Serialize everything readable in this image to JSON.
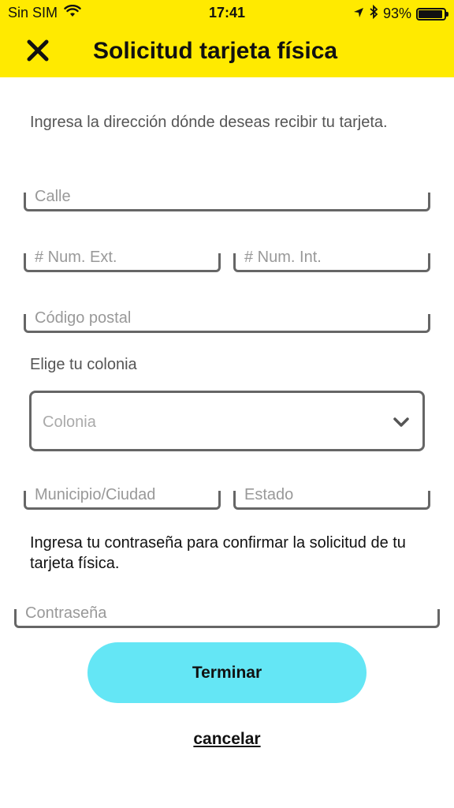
{
  "status_bar": {
    "carrier": "Sin SIM",
    "time": "17:41",
    "battery": "93%",
    "battery_level": 0.93
  },
  "header": {
    "title": "Solicitud tarjeta física",
    "close_icon": "close-icon"
  },
  "form": {
    "intro": "Ingresa la dirección dónde deseas recibir tu tarjeta.",
    "street_placeholder": "Calle",
    "ext_num_placeholder": "# Num. Ext.",
    "int_num_placeholder": "# Num. Int.",
    "postal_code_placeholder": "Código postal",
    "colonia_label": "Elige tu colonia",
    "colonia_placeholder": "Colonia",
    "municipio_placeholder": "Municipio/Ciudad",
    "estado_placeholder": "Estado",
    "confirm_text": "Ingresa tu contraseña para confirmar la solicitud de tu tarjeta física.",
    "password_placeholder": "Contraseña"
  },
  "actions": {
    "finish_label": "Terminar",
    "cancel_label": "cancelar"
  },
  "colors": {
    "header_bg": "#ffea00",
    "primary_button": "#64e6f5"
  }
}
